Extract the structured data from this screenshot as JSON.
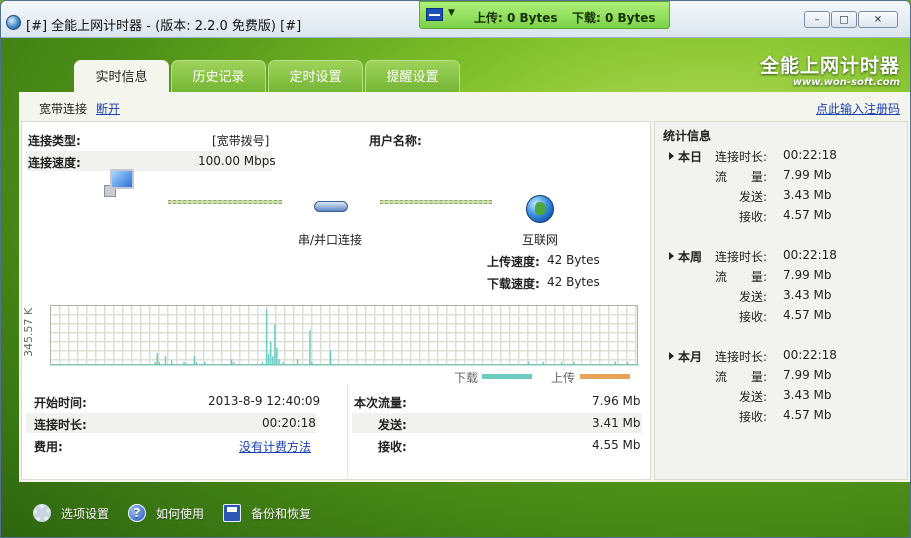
{
  "window": {
    "title": "[#] 全能上网计时器 - (版本: 2.2.0 免费版) [#]",
    "min": "–",
    "max": "□",
    "close": "✕"
  },
  "speedbar": {
    "upload": "上传: 0 Bytes",
    "download": "下载: 0 Bytes"
  },
  "brand": {
    "name": "全能上网计时器",
    "url": "www.won-soft.com"
  },
  "tabs": [
    "实时信息",
    "历史记录",
    "定时设置",
    "提醒设置"
  ],
  "subbar": {
    "conn_label": "宽带连接",
    "disconnect": "断开",
    "register": "点此输入注册码"
  },
  "connection": {
    "type_label": "连接类型:",
    "type_value": "[宽带拨号]",
    "speed_label": "连接速度:",
    "speed_value": "100.00 Mbps",
    "user_label": "用户名称:",
    "user_value": "",
    "modem_label": "串/并口连接",
    "internet_label": "互联网",
    "up_label": "上传速度:",
    "up_value": "42 Bytes",
    "down_label": "下载速度:",
    "down_value": "42 Bytes"
  },
  "chart_data": {
    "type": "area",
    "ylabel": "345.57 K",
    "series": [
      {
        "name": "下载",
        "color": "#6dcbbf",
        "values": [
          0,
          0,
          0,
          0,
          0,
          0,
          0,
          0,
          0,
          0,
          0,
          0,
          0,
          0,
          0,
          0,
          0,
          0,
          0,
          0,
          0,
          0,
          0,
          0,
          0,
          0,
          0,
          0,
          0,
          0,
          0,
          0,
          0,
          0,
          0,
          0,
          0,
          0,
          0,
          0,
          0,
          0,
          0,
          0,
          0,
          0,
          0,
          0,
          0,
          0,
          0.05,
          0.2,
          0.05,
          0,
          0,
          0.15,
          0,
          0,
          0.08,
          0,
          0,
          0,
          0,
          0,
          0.05,
          0.03,
          0,
          0,
          0,
          0.15,
          0.05,
          0,
          0,
          0,
          0.05,
          0.02,
          0,
          0,
          0,
          0,
          0,
          0,
          0,
          0,
          0,
          0,
          0,
          0.1,
          0.05,
          0,
          0.02,
          0,
          0,
          0,
          0,
          0,
          0,
          0,
          0,
          0,
          0,
          0,
          0.05,
          0,
          0.95,
          0.2,
          0.4,
          0.15,
          0.7,
          0.3,
          0.1,
          0,
          0.05,
          0,
          0,
          0,
          0,
          0,
          0,
          0.1,
          0,
          0,
          0,
          0,
          0,
          0.6,
          0.05,
          0,
          0,
          0,
          0,
          0,
          0,
          0,
          0,
          0.25,
          0,
          0,
          0,
          0,
          0,
          0,
          0,
          0,
          0,
          0,
          0,
          0,
          0,
          0,
          0,
          0,
          0,
          0,
          0,
          0,
          0,
          0,
          0,
          0,
          0,
          0,
          0,
          0,
          0,
          0,
          0,
          0,
          0,
          0,
          0,
          0,
          0,
          0,
          0,
          0,
          0,
          0,
          0,
          0,
          0,
          0,
          0,
          0,
          0,
          0,
          0,
          0,
          0,
          0,
          0,
          0,
          0,
          0,
          0,
          0,
          0,
          0,
          0,
          0,
          0,
          0,
          0,
          0,
          0,
          0,
          0,
          0,
          0,
          0,
          0,
          0,
          0,
          0,
          0,
          0,
          0,
          0,
          0,
          0,
          0,
          0,
          0,
          0,
          0,
          0,
          0,
          0,
          0,
          0,
          0,
          0.06,
          0,
          0,
          0,
          0,
          0,
          0,
          0.05,
          0,
          0,
          0,
          0,
          0,
          0,
          0,
          0,
          0.05,
          0,
          0,
          0,
          0,
          0,
          0.05,
          0,
          0,
          0,
          0,
          0,
          0,
          0,
          0,
          0,
          0,
          0,
          0,
          0,
          0,
          0,
          0,
          0,
          0,
          0,
          0.06,
          0,
          0,
          0,
          0,
          0,
          0.05,
          0,
          0,
          0,
          0,
          0
        ]
      },
      {
        "name": "上传",
        "color": "#e7a458",
        "values": []
      }
    ]
  },
  "session": {
    "start_label": "开始时间:",
    "start_value": "2013-8-9 12:40:09",
    "duration_label": "连接时长:",
    "duration_value": "00:20:18",
    "fee_label": "费用:",
    "fee_value": "没有计费方法",
    "traffic_label": "本次流量:",
    "traffic_value": "7.96 Mb",
    "sent_label": "发送:",
    "sent_value": "3.41 Mb",
    "recv_label": "接收:",
    "recv_value": "4.55 Mb"
  },
  "stats": {
    "title": "统计信息",
    "groups": [
      {
        "name": "本日",
        "time_label": "连接时长:",
        "time": "00:22:18",
        "flow_label": "流　　量:",
        "flow": "7.99 Mb",
        "sent_label": "发送:",
        "sent": "3.43 Mb",
        "recv_label": "接收:",
        "recv": "4.57 Mb"
      },
      {
        "name": "本周",
        "time_label": "连接时长:",
        "time": "00:22:18",
        "flow_label": "流　　量:",
        "flow": "7.99 Mb",
        "sent_label": "发送:",
        "sent": "3.43 Mb",
        "recv_label": "接收:",
        "recv": "4.57 Mb"
      },
      {
        "name": "本月",
        "time_label": "连接时长:",
        "time": "00:22:18",
        "flow_label": "流　　量:",
        "flow": "7.99 Mb",
        "sent_label": "发送:",
        "sent": "3.43 Mb",
        "recv_label": "接收:",
        "recv": "4.57 Mb"
      }
    ]
  },
  "bottom": {
    "settings": "选项设置",
    "help": "如何使用",
    "backup": "备份和恢复"
  }
}
